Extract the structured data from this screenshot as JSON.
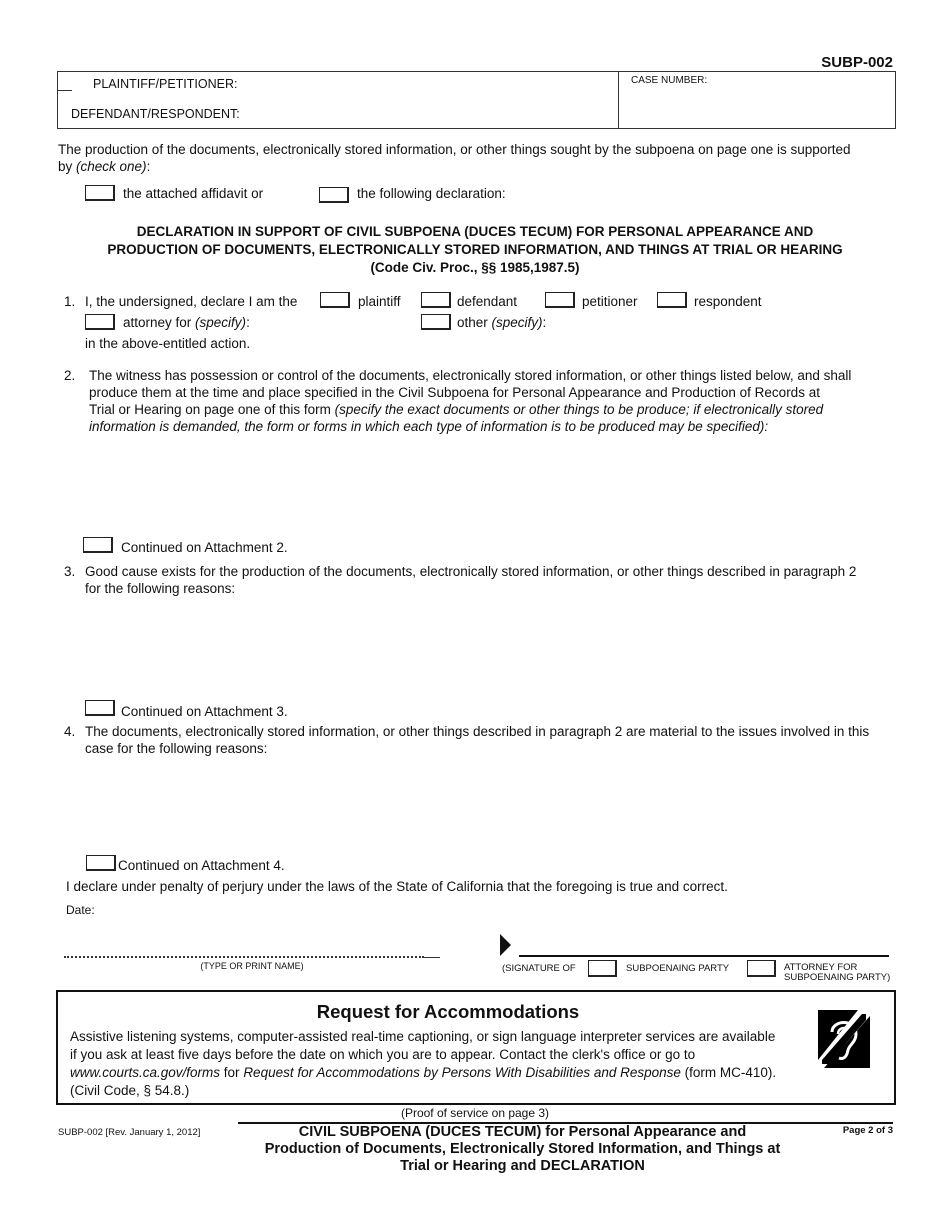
{
  "form_id": "SUBP-002",
  "caption": {
    "plaintiff_label": "PLAINTIFF/PETITIONER:",
    "defendant_label": "DEFENDANT/RESPONDENT:",
    "case_number_label": "CASE NUMBER:",
    "case_number_value": ""
  },
  "intro": {
    "text_main": "The production of the documents, electronically stored information, or other things sought by the subpoena on page one is supported",
    "text_by": "by ",
    "text_check": "(check one)",
    "text_colon": ":",
    "option_affidavit": "the attached affidavit or",
    "option_declaration": "the following declaration:"
  },
  "declaration_title": {
    "line1": "DECLARATION IN SUPPORT OF CIVIL SUBPOENA (DUCES TECUM) FOR PERSONAL APPEARANCE AND",
    "line2": "PRODUCTION OF DOCUMENTS, ELECTRONICALLY STORED INFORMATION, AND THINGS AT TRIAL OR HEARING",
    "line3": "(Code Civ. Proc., §§ 1985,1987.5)"
  },
  "item1": {
    "number": "1.",
    "text": "I, the undersigned, declare I am the",
    "options": [
      "plaintiff",
      "defendant",
      "petitioner",
      "respondent"
    ],
    "attorney_label": "attorney for ",
    "attorney_specify": "(specify)",
    "other_label": "other ",
    "other_specify": "(specify)",
    "colon": ":",
    "action_text": "in the above-entitled action."
  },
  "item2": {
    "number": "2.",
    "line1": "The witness has possession or control of the documents, electronically stored information, or other things listed below, and shall",
    "line2": "produce them at the time and place specified in the Civil Subpoena for Personal Appearance and Production of Records at",
    "line3_plain": "Trial or Hearing on page one of this form ",
    "line3_italic": "(specify the exact documents or other things to be produce; if electronically stored",
    "line4_italic": "information is demanded, the form or forms in which each type of information is to be produced may be specified):",
    "continued": "Continued on Attachment 2."
  },
  "item3": {
    "number": "3.",
    "line1": "Good cause exists for the production of the documents, electronically stored information, or other things described in paragraph 2",
    "line2": "for the following reasons:",
    "continued": "Continued on Attachment 3."
  },
  "item4": {
    "number": "4.",
    "line1": "The documents, electronically stored information, or other things described in paragraph 2 are material to the issues involved in this",
    "line2": "case for the following reasons:",
    "continued": "Continued on Attachment 4."
  },
  "perjury": "I declare under penalty of perjury under the laws of the State of California that the foregoing is true and correct.",
  "date_label": "Date:",
  "signature": {
    "name_caption": "(TYPE OR PRINT NAME)",
    "sig_prefix": "(SIGNATURE OF",
    "party_label": "SUBPOENAING PARTY",
    "attorney_line1": "ATTORNEY FOR",
    "attorney_line2": "SUBPOENAING PARTY)"
  },
  "accommodations": {
    "title": "Request for Accommodations",
    "line1": "Assistive listening systems, computer-assisted real-time captioning, or sign language interpreter services are available",
    "line2": "if you ask at least five days before the date on which you are to appear. Contact the clerk's office or go to",
    "line3_link": "www.courts.ca.gov/forms",
    "line3_for": " for ",
    "line3_italic": "Request for Accommodations by Persons With Disabilities and Response",
    "line3_end": " (form MC-410).",
    "line4": "(Civil Code, § 54.8.)",
    "icon": "hearing-assistance-icon"
  },
  "footer": {
    "proof": "(Proof of service on page 3)",
    "rev": "SUBP-002 [Rev. January 1, 2012]",
    "title1": "CIVIL SUBPOENA (DUCES TECUM) for Personal Appearance and",
    "title2": "Production of Documents, Electronically Stored Information, and Things at",
    "title3": "Trial or Hearing and DECLARATION",
    "page": "Page 2 of 3"
  }
}
